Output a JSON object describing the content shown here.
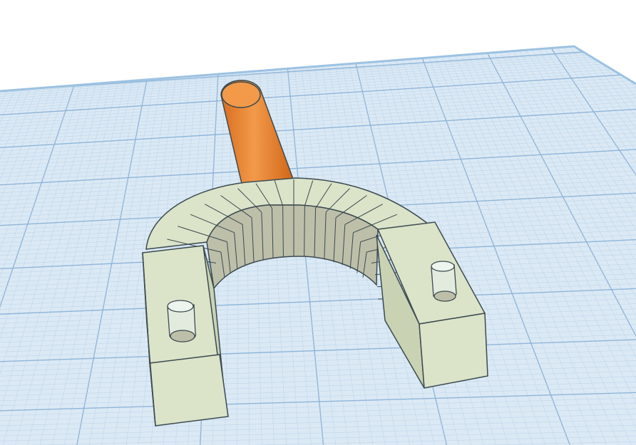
{
  "app": {
    "view": "3d-workplane"
  },
  "colors": {
    "background": "#ffffff",
    "workplane": "#dbe9f5",
    "grid_minor": "#bfd6ea",
    "grid_major": "#8fb5d8",
    "workplane_edge": "#9cc2e2",
    "part_face": "#dbe3c9",
    "part_side": "#c9d3b4",
    "part_shadow": "#bdbfa9",
    "part_outline": "#3c4a50",
    "rod_light": "#f29a4a",
    "rod_dark": "#d96d1f",
    "peg": "#e5eee6"
  },
  "scene": {
    "objects": [
      {
        "name": "orange-cylinder",
        "shape": "cylinder",
        "color": "orange"
      },
      {
        "name": "u-bracket",
        "shape": "horseshoe",
        "color": "sage",
        "segments": 24
      },
      {
        "name": "left-peg",
        "shape": "cylinder",
        "color": "transparent"
      },
      {
        "name": "right-peg",
        "shape": "cylinder",
        "color": "transparent"
      }
    ]
  }
}
